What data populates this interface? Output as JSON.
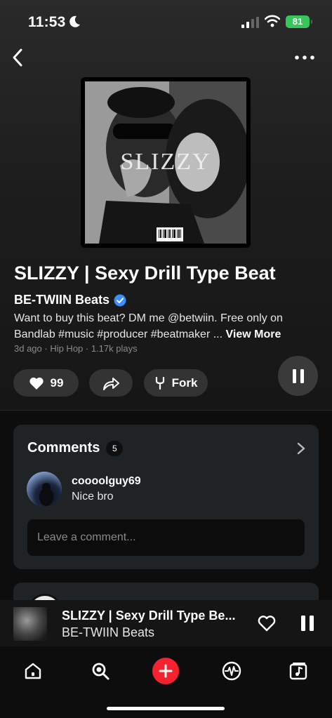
{
  "status": {
    "time": "11:53",
    "battery": "81"
  },
  "cover": {
    "text": "SLIZZY"
  },
  "track": {
    "title": "SLIZZY | Sexy Drill Type Beat",
    "artist": "BE-TWIIN Beats",
    "description": "Want to buy this beat? DM me @betwiin. Free only on Bandlab #music #producer #beatmaker ... ",
    "view_more": "View More",
    "meta": "3d ago  ·  Hip Hop  ·  1.17k plays"
  },
  "actions": {
    "likes": "99",
    "fork_label": "Fork"
  },
  "comments": {
    "title": "Comments",
    "count": "5",
    "items": [
      {
        "user": "coooolguy69",
        "text": "Nice bro"
      }
    ],
    "placeholder": "Leave a comment..."
  },
  "mini_player": {
    "title": "SLIZZY | Sexy Drill Type Be...",
    "artist": "BE-TWIIN Beats"
  },
  "icons": [
    "back-icon",
    "more-icon",
    "heart-icon",
    "share-icon",
    "fork-icon",
    "pause-icon",
    "chevron-right-icon",
    "home-icon",
    "search-icon",
    "create-icon",
    "feed-icon",
    "library-icon"
  ],
  "colors": {
    "accent_red": "#f5232e",
    "verified_blue": "#3d8ef7",
    "battery_green": "#35c759"
  }
}
